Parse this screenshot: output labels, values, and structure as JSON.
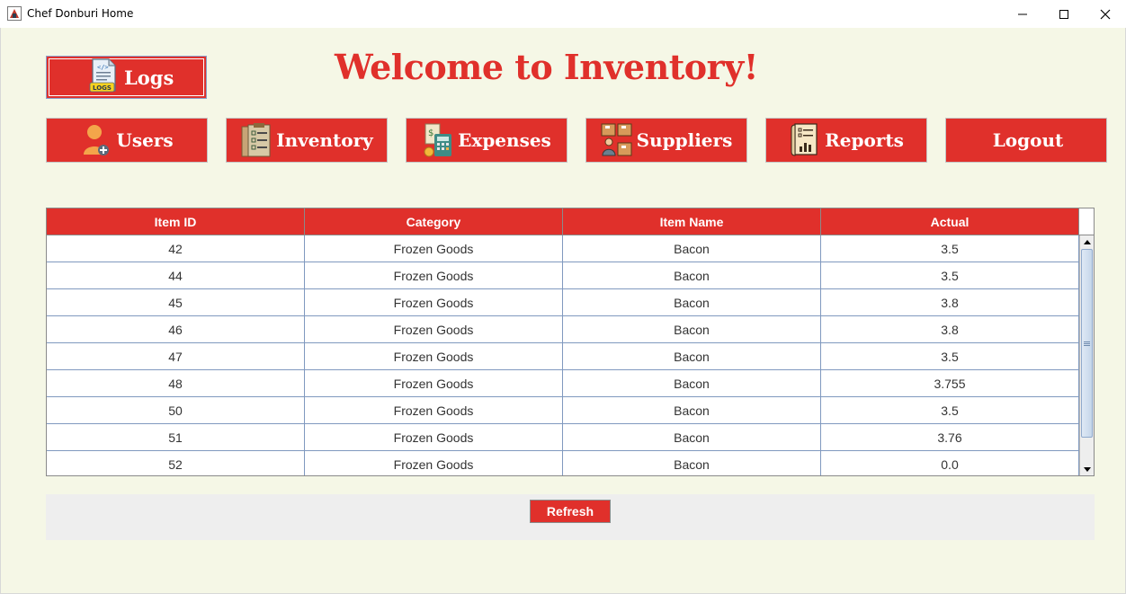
{
  "window": {
    "title": "Chef Donburi Home",
    "controls": [
      "minimize-icon",
      "maximize-icon",
      "close-icon"
    ]
  },
  "logs_button": {
    "label": "Logs",
    "icon": "logs-document-icon",
    "icon_text": "LOGS"
  },
  "heading": "Welcome to Inventory!",
  "nav": [
    {
      "label": "Users",
      "icon": "user-add-icon"
    },
    {
      "label": "Inventory",
      "icon": "clipboard-checklist-icon"
    },
    {
      "label": "Expenses",
      "icon": "calculator-coins-icon"
    },
    {
      "label": "Suppliers",
      "icon": "supplier-boxes-icon"
    },
    {
      "label": "Reports",
      "icon": "report-chart-icon"
    },
    {
      "label": "Logout",
      "icon": ""
    }
  ],
  "table": {
    "columns": [
      "Item ID",
      "Category",
      "Item Name",
      "Actual"
    ],
    "rows": [
      [
        "42",
        "Frozen Goods",
        "Bacon",
        "3.5"
      ],
      [
        "44",
        "Frozen Goods",
        "Bacon",
        "3.5"
      ],
      [
        "45",
        "Frozen Goods",
        "Bacon",
        "3.8"
      ],
      [
        "46",
        "Frozen Goods",
        "Bacon",
        "3.8"
      ],
      [
        "47",
        "Frozen Goods",
        "Bacon",
        "3.5"
      ],
      [
        "48",
        "Frozen Goods",
        "Bacon",
        "3.755"
      ],
      [
        "50",
        "Frozen Goods",
        "Bacon",
        "3.5"
      ],
      [
        "51",
        "Frozen Goods",
        "Bacon",
        "3.76"
      ],
      [
        "52",
        "Frozen Goods",
        "Bacon",
        "0.0"
      ]
    ]
  },
  "refresh_button": {
    "label": "Refresh"
  },
  "colors": {
    "accent": "#e0302b",
    "background": "#f5f7e6",
    "panel": "#eeeeee",
    "text": "#333333"
  }
}
